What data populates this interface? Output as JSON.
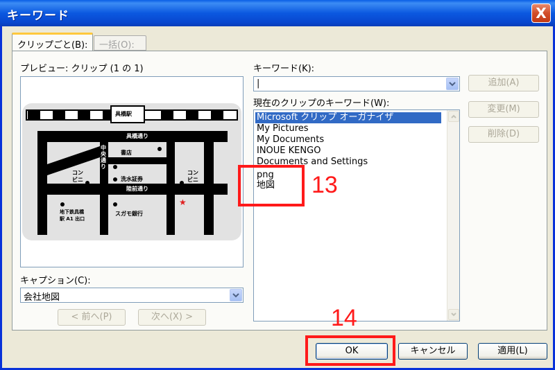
{
  "window": {
    "title": "キーワード",
    "close_glyph": "X"
  },
  "tabs": [
    {
      "label": "クリップごと(B):",
      "active": true
    },
    {
      "label": "一括(O):",
      "active": false
    }
  ],
  "preview": {
    "label": "プレビュー:  クリップ (1 の 1)",
    "map_labels": {
      "station": "具橋駅",
      "street_top": "具橋通り",
      "street_mid": "陸前通り",
      "avenue": "中央通り",
      "bookstore": "書店",
      "bldg": "洗水証券",
      "conv_left": "コン\nビニ",
      "conv_right": "コン\nビニ",
      "subway": "地下鉄具橋\n駅 A1 出口",
      "bank": "スガモ銀行",
      "star": "★"
    }
  },
  "caption": {
    "label": "キャプション(C):",
    "value": "会社地図"
  },
  "nav": {
    "prev": "< 前へ(P)",
    "next": "次へ(X) >"
  },
  "keyword": {
    "label": "キーワード(K):",
    "value": "|"
  },
  "current_keywords": {
    "label": "現在のクリップのキーワード(W):",
    "items": [
      "Microsoft クリップ オーガナイザ",
      "My Pictures",
      "My Documents",
      "INOUE KENGO",
      "Documents and Settings",
      "png",
      "地図"
    ],
    "selected_index": 0
  },
  "side_buttons": {
    "add": "追加(A)",
    "change": "変更(M)",
    "delete": "削除(D)"
  },
  "footer": {
    "ok": "OK",
    "cancel": "キャンセル",
    "apply": "適用(L)"
  },
  "annotations": {
    "n13": "13",
    "n14": "14",
    "color": "#ff1a1a"
  }
}
